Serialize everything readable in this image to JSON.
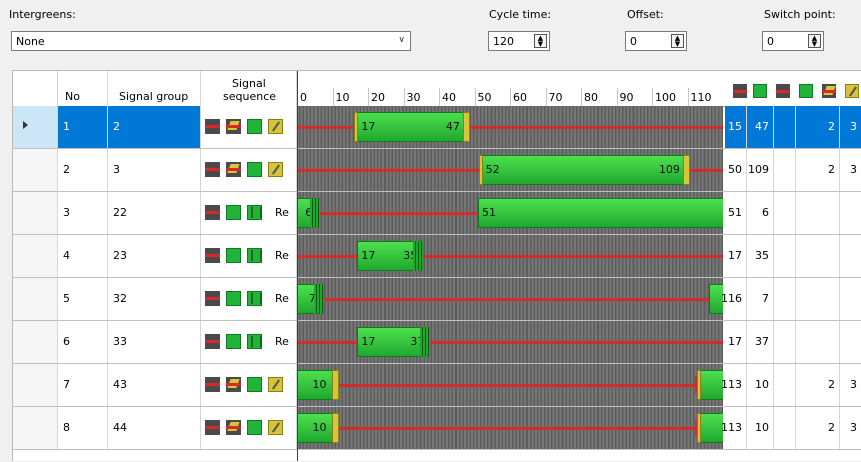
{
  "controls": {
    "intergreens_label": "Intergreens:",
    "intergreens_value": "None",
    "cycle_label": "Cycle time:",
    "cycle_value": "120",
    "offset_label": "Offset:",
    "offset_value": "0",
    "switch_label": "Switch point:",
    "switch_value": "0"
  },
  "grid": {
    "col_no": "No",
    "col_group": "Signal group",
    "col_seq_line1": "Signal",
    "col_seq_line2": "sequence",
    "ticks": [
      "0",
      "10",
      "20",
      "30",
      "40",
      "50",
      "60",
      "70",
      "80",
      "90",
      "100",
      "110"
    ],
    "rows": [
      {
        "no": "1",
        "group": "2",
        "seq": [
          "red",
          "redamber",
          "green",
          "amber"
        ],
        "re": "",
        "a": "15",
        "b": "47",
        "c": "",
        "d": "2",
        "e": "3",
        "selected": true,
        "bar": {
          "start": 17,
          "end": 47,
          "label_start": "17",
          "label_end": "47",
          "type": "amber"
        }
      },
      {
        "no": "2",
        "group": "3",
        "seq": [
          "red",
          "redamber",
          "green",
          "amber"
        ],
        "re": "",
        "a": "50",
        "b": "109",
        "c": "",
        "d": "2",
        "e": "3",
        "selected": false,
        "bar": {
          "start": 52,
          "end": 109,
          "label_start": "52",
          "label_end": "109",
          "type": "amber"
        }
      },
      {
        "no": "3",
        "group": "22",
        "seq": [
          "red",
          "green",
          "flash"
        ],
        "re": "Re",
        "a": "51",
        "b": "6",
        "c": "",
        "d": "",
        "e": "",
        "selected": false,
        "bar": {
          "start": 51,
          "end": 120,
          "label_start": "51",
          "label_end": "",
          "type": "wrap",
          "wrap_end": 6,
          "wrap_label": "6"
        }
      },
      {
        "no": "4",
        "group": "23",
        "seq": [
          "red",
          "green",
          "flash"
        ],
        "re": "Re",
        "a": "17",
        "b": "35",
        "c": "",
        "d": "",
        "e": "",
        "selected": false,
        "bar": {
          "start": 17,
          "end": 35,
          "label_start": "17",
          "label_end": "35",
          "type": "flash"
        }
      },
      {
        "no": "5",
        "group": "32",
        "seq": [
          "red",
          "green",
          "flash"
        ],
        "re": "Re",
        "a": "116",
        "b": "7",
        "c": "",
        "d": "",
        "e": "",
        "selected": false,
        "bar": {
          "start": 116,
          "end": 120,
          "label_start": "",
          "label_end": "",
          "type": "wrap",
          "wrap_end": 7,
          "wrap_label": "7"
        }
      },
      {
        "no": "6",
        "group": "33",
        "seq": [
          "red",
          "green",
          "flash"
        ],
        "re": "Re",
        "a": "17",
        "b": "37",
        "c": "",
        "d": "",
        "e": "",
        "selected": false,
        "bar": {
          "start": 17,
          "end": 37,
          "label_start": "17",
          "label_end": "37",
          "type": "flash"
        }
      },
      {
        "no": "7",
        "group": "43",
        "seq": [
          "red",
          "redamber",
          "green",
          "amber"
        ],
        "re": "",
        "a": "113",
        "b": "10",
        "c": "",
        "d": "2",
        "e": "3",
        "selected": false,
        "bar": {
          "start": 113,
          "end": 120,
          "label_start": "",
          "label_end": "",
          "type": "wrapamber",
          "wrap_end": 10,
          "wrap_label": "10"
        }
      },
      {
        "no": "8",
        "group": "44",
        "seq": [
          "red",
          "redamber",
          "green",
          "amber"
        ],
        "re": "",
        "a": "113",
        "b": "10",
        "c": "",
        "d": "2",
        "e": "3",
        "selected": false,
        "bar": {
          "start": 113,
          "end": 120,
          "label_start": "",
          "label_end": "",
          "type": "wrapamber",
          "wrap_end": 10,
          "wrap_label": "10"
        }
      }
    ]
  }
}
